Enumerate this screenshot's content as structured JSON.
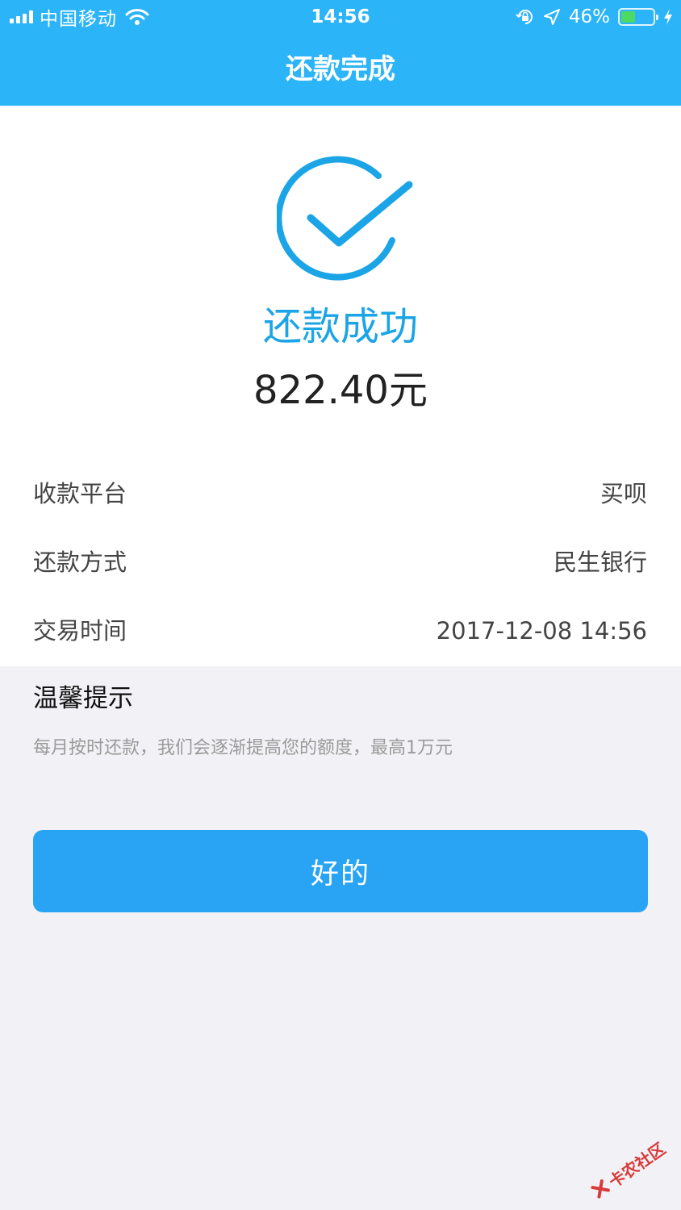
{
  "status_bar": {
    "carrier": "中国移动",
    "time": "14:56",
    "battery_percent": "46%",
    "battery_level": 0.46,
    "icons": [
      "signal-icon",
      "wifi-icon",
      "orientation-lock-icon",
      "location-icon",
      "battery-icon",
      "charging-icon"
    ]
  },
  "header": {
    "title": "还款完成"
  },
  "result": {
    "icon": "check-circle-icon",
    "status": "还款成功",
    "amount": "822.40元",
    "accent_color": "#1ba4e6"
  },
  "details": [
    {
      "label": "收款平台",
      "value": "买呗"
    },
    {
      "label": "还款方式",
      "value": "民生银行"
    },
    {
      "label": "交易时间",
      "value": "2017-12-08 14:56"
    }
  ],
  "tips": {
    "title": "温馨提示",
    "text": "每月按时还款，我们会逐渐提高您的额度，最高1万元"
  },
  "actions": {
    "ok_label": "好的"
  },
  "watermark": {
    "text": "卡农社区"
  },
  "colors": {
    "header": "#2cb4f9",
    "button": "#29a3f3",
    "background": "#f2f2f6"
  }
}
